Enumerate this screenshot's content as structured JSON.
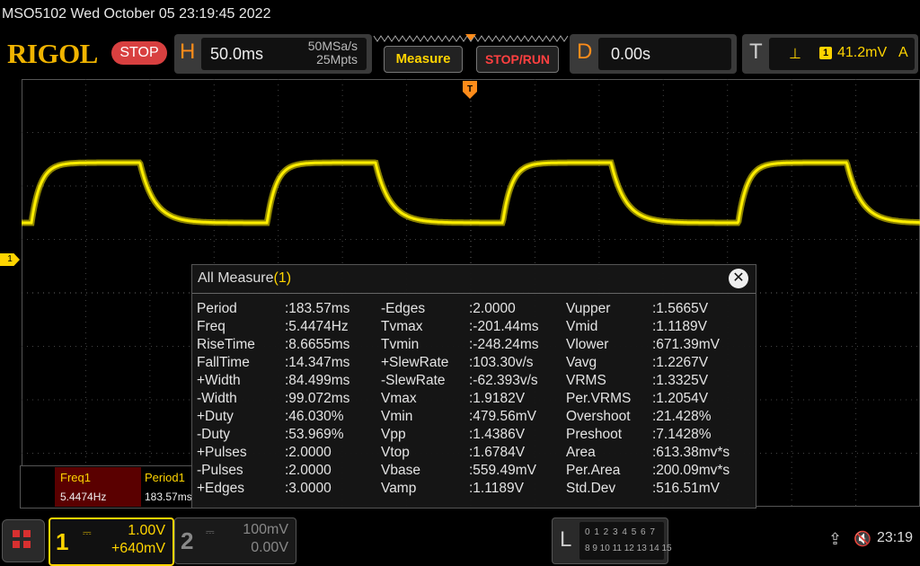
{
  "window": {
    "title": "MSO5102  Wed October 05 23:19:45 2022"
  },
  "toolbar": {
    "logo": "RIGOL",
    "status": "STOP",
    "horizontal": {
      "letter": "H",
      "timebase": "50.0ms",
      "sample_rate": "50MSa/s",
      "memory_depth": "25Mpts"
    },
    "measure_button": "Measure",
    "stoprun_button": "STOP/RUN",
    "delay": {
      "letter": "D",
      "value": "0.00s"
    },
    "trigger": {
      "letter": "T",
      "edge_icon": "rising-edge-icon",
      "edge_glyph": "⊥",
      "source": "1",
      "level": "41.2mV",
      "mode": "A"
    }
  },
  "waveform": {
    "channel_marker": "1",
    "color": "#ffee00",
    "period_ms": 183.57,
    "positive_width_ms": 84.499,
    "vmax_V": 1.9182,
    "vmin_V": 0.47956,
    "vtop_V": 1.6784,
    "vbase_V": 0.55949
  },
  "measure_panel": {
    "title": "All Measure",
    "count": "(1)",
    "close_glyph": "✕",
    "columns": [
      [
        {
          "label": "Period",
          "value": ":183.57ms"
        },
        {
          "label": "Freq",
          "value": ":5.4474Hz"
        },
        {
          "label": "RiseTime",
          "value": ":8.6655ms"
        },
        {
          "label": "FallTime",
          "value": ":14.347ms"
        },
        {
          "label": "+Width",
          "value": ":84.499ms"
        },
        {
          "label": "-Width",
          "value": ":99.072ms"
        },
        {
          "label": "+Duty",
          "value": ":46.030%"
        },
        {
          "label": "-Duty",
          "value": ":53.969%"
        },
        {
          "label": "+Pulses",
          "value": ":2.0000"
        },
        {
          "label": "-Pulses",
          "value": ":2.0000"
        },
        {
          "label": "+Edges",
          "value": ":3.0000"
        }
      ],
      [
        {
          "label": "-Edges",
          "value": ":2.0000"
        },
        {
          "label": "Tvmax",
          "value": ":-201.44ms"
        },
        {
          "label": "Tvmin",
          "value": ":-248.24ms"
        },
        {
          "label": "+SlewRate",
          "value": ":103.30v/s"
        },
        {
          "label": "-SlewRate",
          "value": ":-62.393v/s"
        },
        {
          "label": "Vmax",
          "value": ":1.9182V"
        },
        {
          "label": "Vmin",
          "value": ":479.56mV"
        },
        {
          "label": "Vpp",
          "value": ":1.4386V"
        },
        {
          "label": "Vtop",
          "value": ":1.6784V"
        },
        {
          "label": "Vbase",
          "value": ":559.49mV"
        },
        {
          "label": "Vamp",
          "value": ":1.1189V"
        }
      ],
      [
        {
          "label": "Vupper",
          "value": ":1.5665V"
        },
        {
          "label": "Vmid",
          "value": ":1.1189V"
        },
        {
          "label": "Vlower",
          "value": ":671.39mV"
        },
        {
          "label": "Vavg",
          "value": ":1.2267V"
        },
        {
          "label": "VRMS",
          "value": ":1.3325V"
        },
        {
          "label": "Per.VRMS",
          "value": ":1.2054V"
        },
        {
          "label": "Overshoot",
          "value": ":21.428%"
        },
        {
          "label": "Preshoot",
          "value": ":7.1428%"
        },
        {
          "label": "Area",
          "value": ":613.38mv*s"
        },
        {
          "label": "Per.Area",
          "value": ":200.09mv*s"
        },
        {
          "label": "Std.Dev",
          "value": ":516.51mV"
        }
      ]
    ]
  },
  "mini_measure": {
    "item1": {
      "label": "Freq1",
      "value": "5.4474Hz"
    },
    "item2": {
      "label": "Period1",
      "value": "183.57ms"
    }
  },
  "bottombar": {
    "ch1": {
      "number": "1",
      "scale": "1.00V",
      "offset": "+640mV"
    },
    "ch2": {
      "number": "2",
      "scale": "100mV",
      "offset": "0.00V"
    },
    "logic": {
      "letter": "L",
      "row1": "0 1 2 3  4 5 6 7",
      "row2": "8 9 10 11 12 13 14 15"
    },
    "usb_glyph": "⇪",
    "speaker_glyph": "🔇",
    "clock": "23:19"
  }
}
